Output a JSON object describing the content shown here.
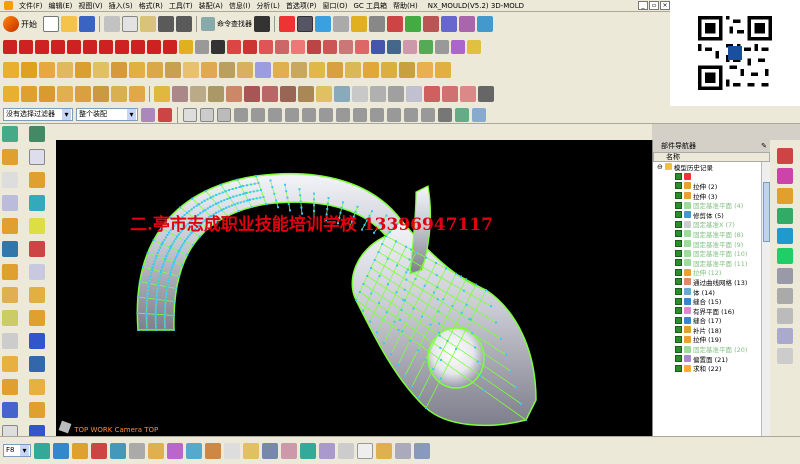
{
  "menu": {
    "items": [
      "文件(F)",
      "编辑(E)",
      "视图(V)",
      "插入(S)",
      "格式(R)",
      "工具(T)",
      "装配(A)",
      "信息(I)",
      "分析(L)",
      "首选项(P)",
      "窗口(O)",
      "GC 工具箱",
      "帮助(H)"
    ],
    "app_title": "NX_MOULD(V5.2)  3D-MOLD"
  },
  "toolbar": {
    "start_label": "开始",
    "command_finder_label": "命令查找器"
  },
  "filterbar": {
    "selection_filter": "没有选择过滤器",
    "assembly_scope": "整个装配"
  },
  "viewport": {
    "watermark": "二.亭市志成职业技能培训学校 13396947117",
    "camera_label": "TOP WORK Camera TOP"
  },
  "navigator": {
    "title": "部件导航器",
    "column_name": "名称",
    "root": "模型历史记录",
    "features": [
      {
        "label": "",
        "dim": false
      },
      {
        "label": "拉伸 (2)",
        "dim": false
      },
      {
        "label": "拉伸 (3)",
        "dim": false
      },
      {
        "label": "固定基准平面 (4)",
        "dim": true
      },
      {
        "label": "修剪体 (5)",
        "dim": false
      },
      {
        "label": "固定基准X (7)",
        "dim": true
      },
      {
        "label": "固定基准平面 (8)",
        "dim": true
      },
      {
        "label": "固定基准平面 (9)",
        "dim": true
      },
      {
        "label": "固定基准平面 (10)",
        "dim": true
      },
      {
        "label": "固定基准平面 (11)",
        "dim": true
      },
      {
        "label": "拉伸 (12)",
        "dim": true
      },
      {
        "label": "通过曲线网格 (13)",
        "dim": false
      },
      {
        "label": "体 (14)",
        "dim": false
      },
      {
        "label": "缝合 (15)",
        "dim": false
      },
      {
        "label": "有界平面 (16)",
        "dim": false
      },
      {
        "label": "缝合 (17)",
        "dim": false
      },
      {
        "label": "补片 (18)",
        "dim": false
      },
      {
        "label": "拉伸 (19)",
        "dim": false
      },
      {
        "label": "固定基准平面 (20)",
        "dim": true
      },
      {
        "label": "偏置面 (21)",
        "dim": false
      },
      {
        "label": "求和 (22)",
        "dim": false
      }
    ]
  },
  "colors": {
    "background": "#000000",
    "watermark": "#e0000f",
    "mesh": "#7dff3a",
    "surface": "#c8c8d2"
  },
  "bottombar": {
    "selector_value": "F8"
  }
}
